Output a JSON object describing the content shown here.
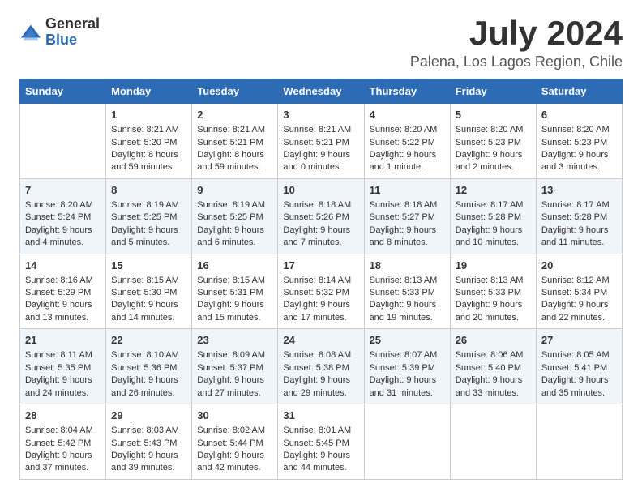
{
  "logo": {
    "general": "General",
    "blue": "Blue"
  },
  "title": "July 2024",
  "location": "Palena, Los Lagos Region, Chile",
  "days_of_week": [
    "Sunday",
    "Monday",
    "Tuesday",
    "Wednesday",
    "Thursday",
    "Friday",
    "Saturday"
  ],
  "weeks": [
    [
      {
        "day": null,
        "data": null
      },
      {
        "day": "1",
        "sunrise": "Sunrise: 8:21 AM",
        "sunset": "Sunset: 5:20 PM",
        "daylight": "Daylight: 8 hours and 59 minutes."
      },
      {
        "day": "2",
        "sunrise": "Sunrise: 8:21 AM",
        "sunset": "Sunset: 5:21 PM",
        "daylight": "Daylight: 8 hours and 59 minutes."
      },
      {
        "day": "3",
        "sunrise": "Sunrise: 8:21 AM",
        "sunset": "Sunset: 5:21 PM",
        "daylight": "Daylight: 9 hours and 0 minutes."
      },
      {
        "day": "4",
        "sunrise": "Sunrise: 8:20 AM",
        "sunset": "Sunset: 5:22 PM",
        "daylight": "Daylight: 9 hours and 1 minute."
      },
      {
        "day": "5",
        "sunrise": "Sunrise: 8:20 AM",
        "sunset": "Sunset: 5:23 PM",
        "daylight": "Daylight: 9 hours and 2 minutes."
      },
      {
        "day": "6",
        "sunrise": "Sunrise: 8:20 AM",
        "sunset": "Sunset: 5:23 PM",
        "daylight": "Daylight: 9 hours and 3 minutes."
      }
    ],
    [
      {
        "day": "7",
        "sunrise": "Sunrise: 8:20 AM",
        "sunset": "Sunset: 5:24 PM",
        "daylight": "Daylight: 9 hours and 4 minutes."
      },
      {
        "day": "8",
        "sunrise": "Sunrise: 8:19 AM",
        "sunset": "Sunset: 5:25 PM",
        "daylight": "Daylight: 9 hours and 5 minutes."
      },
      {
        "day": "9",
        "sunrise": "Sunrise: 8:19 AM",
        "sunset": "Sunset: 5:25 PM",
        "daylight": "Daylight: 9 hours and 6 minutes."
      },
      {
        "day": "10",
        "sunrise": "Sunrise: 8:18 AM",
        "sunset": "Sunset: 5:26 PM",
        "daylight": "Daylight: 9 hours and 7 minutes."
      },
      {
        "day": "11",
        "sunrise": "Sunrise: 8:18 AM",
        "sunset": "Sunset: 5:27 PM",
        "daylight": "Daylight: 9 hours and 8 minutes."
      },
      {
        "day": "12",
        "sunrise": "Sunrise: 8:17 AM",
        "sunset": "Sunset: 5:28 PM",
        "daylight": "Daylight: 9 hours and 10 minutes."
      },
      {
        "day": "13",
        "sunrise": "Sunrise: 8:17 AM",
        "sunset": "Sunset: 5:28 PM",
        "daylight": "Daylight: 9 hours and 11 minutes."
      }
    ],
    [
      {
        "day": "14",
        "sunrise": "Sunrise: 8:16 AM",
        "sunset": "Sunset: 5:29 PM",
        "daylight": "Daylight: 9 hours and 13 minutes."
      },
      {
        "day": "15",
        "sunrise": "Sunrise: 8:15 AM",
        "sunset": "Sunset: 5:30 PM",
        "daylight": "Daylight: 9 hours and 14 minutes."
      },
      {
        "day": "16",
        "sunrise": "Sunrise: 8:15 AM",
        "sunset": "Sunset: 5:31 PM",
        "daylight": "Daylight: 9 hours and 15 minutes."
      },
      {
        "day": "17",
        "sunrise": "Sunrise: 8:14 AM",
        "sunset": "Sunset: 5:32 PM",
        "daylight": "Daylight: 9 hours and 17 minutes."
      },
      {
        "day": "18",
        "sunrise": "Sunrise: 8:13 AM",
        "sunset": "Sunset: 5:33 PM",
        "daylight": "Daylight: 9 hours and 19 minutes."
      },
      {
        "day": "19",
        "sunrise": "Sunrise: 8:13 AM",
        "sunset": "Sunset: 5:33 PM",
        "daylight": "Daylight: 9 hours and 20 minutes."
      },
      {
        "day": "20",
        "sunrise": "Sunrise: 8:12 AM",
        "sunset": "Sunset: 5:34 PM",
        "daylight": "Daylight: 9 hours and 22 minutes."
      }
    ],
    [
      {
        "day": "21",
        "sunrise": "Sunrise: 8:11 AM",
        "sunset": "Sunset: 5:35 PM",
        "daylight": "Daylight: 9 hours and 24 minutes."
      },
      {
        "day": "22",
        "sunrise": "Sunrise: 8:10 AM",
        "sunset": "Sunset: 5:36 PM",
        "daylight": "Daylight: 9 hours and 26 minutes."
      },
      {
        "day": "23",
        "sunrise": "Sunrise: 8:09 AM",
        "sunset": "Sunset: 5:37 PM",
        "daylight": "Daylight: 9 hours and 27 minutes."
      },
      {
        "day": "24",
        "sunrise": "Sunrise: 8:08 AM",
        "sunset": "Sunset: 5:38 PM",
        "daylight": "Daylight: 9 hours and 29 minutes."
      },
      {
        "day": "25",
        "sunrise": "Sunrise: 8:07 AM",
        "sunset": "Sunset: 5:39 PM",
        "daylight": "Daylight: 9 hours and 31 minutes."
      },
      {
        "day": "26",
        "sunrise": "Sunrise: 8:06 AM",
        "sunset": "Sunset: 5:40 PM",
        "daylight": "Daylight: 9 hours and 33 minutes."
      },
      {
        "day": "27",
        "sunrise": "Sunrise: 8:05 AM",
        "sunset": "Sunset: 5:41 PM",
        "daylight": "Daylight: 9 hours and 35 minutes."
      }
    ],
    [
      {
        "day": "28",
        "sunrise": "Sunrise: 8:04 AM",
        "sunset": "Sunset: 5:42 PM",
        "daylight": "Daylight: 9 hours and 37 minutes."
      },
      {
        "day": "29",
        "sunrise": "Sunrise: 8:03 AM",
        "sunset": "Sunset: 5:43 PM",
        "daylight": "Daylight: 9 hours and 39 minutes."
      },
      {
        "day": "30",
        "sunrise": "Sunrise: 8:02 AM",
        "sunset": "Sunset: 5:44 PM",
        "daylight": "Daylight: 9 hours and 42 minutes."
      },
      {
        "day": "31",
        "sunrise": "Sunrise: 8:01 AM",
        "sunset": "Sunset: 5:45 PM",
        "daylight": "Daylight: 9 hours and 44 minutes."
      },
      {
        "day": null,
        "data": null
      },
      {
        "day": null,
        "data": null
      },
      {
        "day": null,
        "data": null
      }
    ]
  ]
}
